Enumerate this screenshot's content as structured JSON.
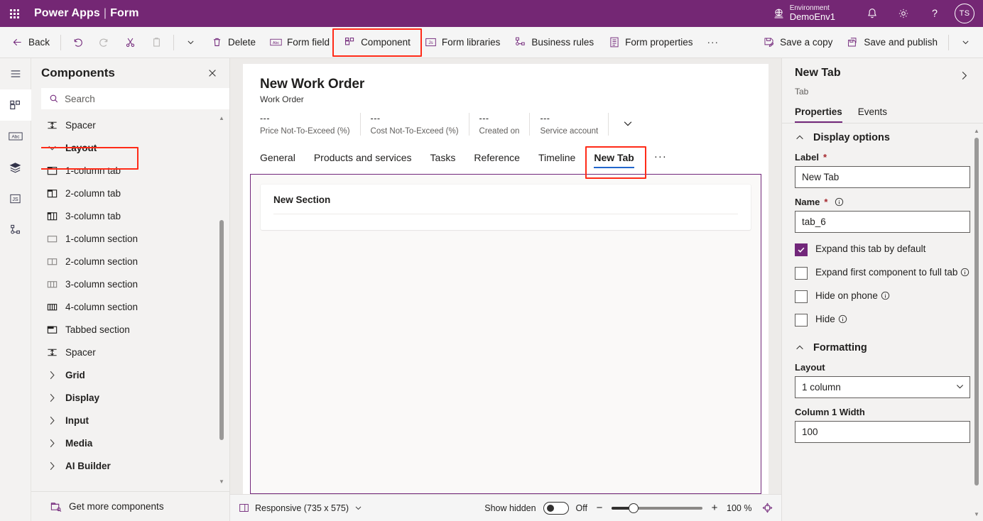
{
  "topbar": {
    "waffle_label": "App launcher",
    "brand": "Power Apps",
    "brand_separator": "|",
    "brand_sub": "Form",
    "environment_label": "Environment",
    "environment_name": "DemoEnv1",
    "notifications_label": "Notifications",
    "settings_label": "Settings",
    "help_label": "Help",
    "avatar_initials": "TS"
  },
  "commandbar": {
    "back": "Back",
    "undo": "Undo",
    "redo": "Redo",
    "cut": "Cut",
    "paste": "Paste",
    "more_chevron": "More",
    "delete": "Delete",
    "form_field": "Form field",
    "component": "Component",
    "form_libraries": "Form libraries",
    "business_rules": "Business rules",
    "form_properties": "Form properties",
    "overflow": "···",
    "save_a_copy": "Save a copy",
    "save_and_publish": "Save and publish",
    "save_chevron": "More save options"
  },
  "rail": {
    "items": [
      {
        "name": "menu",
        "label": "Menu"
      },
      {
        "name": "components",
        "label": "Components"
      },
      {
        "name": "form-fields",
        "label": "Table columns"
      },
      {
        "name": "layers",
        "label": "Tree view"
      },
      {
        "name": "form-libraries",
        "label": "Form libraries"
      },
      {
        "name": "business-rules",
        "label": "Business rules"
      }
    ]
  },
  "components_panel": {
    "title": "Components",
    "close_label": "Close",
    "search_placeholder": "Search",
    "search_value": "",
    "items": [
      {
        "label": "Spacer",
        "icon": "spacer",
        "type": "item",
        "highlight": false
      },
      {
        "label": "Layout",
        "icon": "chevron-down",
        "type": "group",
        "highlight": false
      },
      {
        "label": "1-column tab",
        "icon": "tab-1col",
        "type": "item",
        "highlight": true
      },
      {
        "label": "2-column tab",
        "icon": "tab-2col",
        "type": "item",
        "highlight": false
      },
      {
        "label": "3-column tab",
        "icon": "tab-3col",
        "type": "item",
        "highlight": false
      },
      {
        "label": "1-column section",
        "icon": "section-1col",
        "type": "item",
        "highlight": false
      },
      {
        "label": "2-column section",
        "icon": "section-2col",
        "type": "item",
        "highlight": false
      },
      {
        "label": "3-column section",
        "icon": "section-3col",
        "type": "item",
        "highlight": false
      },
      {
        "label": "4-column section",
        "icon": "section-4col",
        "type": "item",
        "highlight": false
      },
      {
        "label": "Tabbed section",
        "icon": "tabbed-section",
        "type": "item",
        "highlight": false
      },
      {
        "label": "Spacer",
        "icon": "spacer",
        "type": "item",
        "highlight": false
      },
      {
        "label": "Grid",
        "icon": "chevron-right",
        "type": "group",
        "highlight": false
      },
      {
        "label": "Display",
        "icon": "chevron-right",
        "type": "group",
        "highlight": false
      },
      {
        "label": "Input",
        "icon": "chevron-right",
        "type": "group",
        "highlight": false
      },
      {
        "label": "Media",
        "icon": "chevron-right",
        "type": "group",
        "highlight": false
      },
      {
        "label": "AI Builder",
        "icon": "chevron-right",
        "type": "group",
        "highlight": false
      }
    ],
    "footer_label": "Get more components"
  },
  "form": {
    "title": "New Work Order",
    "subtitle": "Work Order",
    "header_fields": [
      {
        "value": "---",
        "label": "Price Not-To-Exceed (%)"
      },
      {
        "value": "---",
        "label": "Cost Not-To-Exceed (%)"
      },
      {
        "value": "---",
        "label": "Created on"
      },
      {
        "value": "---",
        "label": "Service account"
      }
    ],
    "header_chevron_label": "Expand header",
    "tabs": [
      {
        "label": "General",
        "active": false
      },
      {
        "label": "Products and services",
        "active": false
      },
      {
        "label": "Tasks",
        "active": false
      },
      {
        "label": "Reference",
        "active": false
      },
      {
        "label": "Timeline",
        "active": false
      },
      {
        "label": "New Tab",
        "active": true
      }
    ],
    "tabs_overflow": "···",
    "section_title": "New Section"
  },
  "statusbar": {
    "responsive_label": "Responsive (735 x 575)",
    "responsive_chevron": "Change size",
    "show_hidden_label": "Show hidden",
    "show_hidden_state": "Off",
    "zoom_minus": "−",
    "zoom_plus": "+",
    "zoom_level": "100 %",
    "fit_label": "Fit to screen"
  },
  "properties": {
    "title": "New Tab",
    "type": "Tab",
    "expand_label": "Expand panel",
    "tabs": [
      {
        "label": "Properties",
        "active": true
      },
      {
        "label": "Events",
        "active": false
      }
    ],
    "display_options": {
      "section_title": "Display options",
      "label_field_label": "Label",
      "label_field_required": "*",
      "label_field_value": "New Tab",
      "name_field_label": "Name",
      "name_field_required": "*",
      "name_field_value": "tab_6",
      "checkboxes": [
        {
          "label": "Expand this tab by default",
          "checked": true,
          "info": false
        },
        {
          "label": "Expand first component to full tab",
          "checked": false,
          "info": true
        },
        {
          "label": "Hide on phone",
          "checked": false,
          "info": true
        },
        {
          "label": "Hide",
          "checked": false,
          "info": true
        }
      ]
    },
    "formatting": {
      "section_title": "Formatting",
      "layout_label": "Layout",
      "layout_value": "1 column",
      "column1_label": "Column 1 Width",
      "column1_value": "100"
    }
  },
  "colors": {
    "brand_purple": "#742774",
    "selection_purple": "#72277a",
    "annotation_red": "#ff2b18",
    "tab_underline_blue": "#2266cc",
    "canvas_gray": "#edebe9"
  }
}
